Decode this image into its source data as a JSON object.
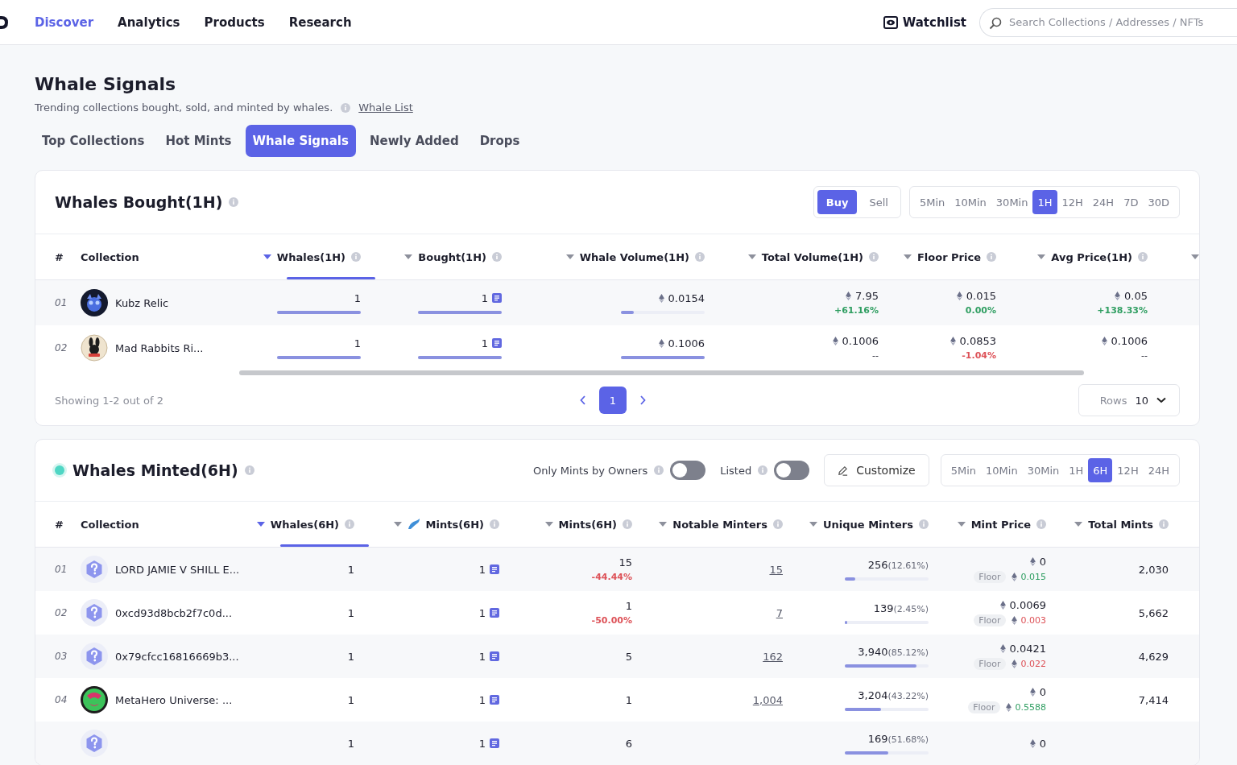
{
  "nav": {
    "items": [
      {
        "label": "Discover",
        "selected": true
      },
      {
        "label": "Analytics",
        "selected": false
      },
      {
        "label": "Products",
        "selected": false
      },
      {
        "label": "Research",
        "selected": false
      }
    ],
    "watchlist": "Watchlist",
    "search_placeholder": "Search Collections / Addresses / NFTs"
  },
  "page": {
    "title": "Whale Signals",
    "subtitle": "Trending collections bought, sold, and minted by whales.",
    "link": "Whale List"
  },
  "tabs": [
    {
      "label": "Top Collections",
      "selected": false
    },
    {
      "label": "Hot Mints",
      "selected": false
    },
    {
      "label": "Whale Signals",
      "selected": true
    },
    {
      "label": "Newly Added",
      "selected": false
    },
    {
      "label": "Drops",
      "selected": false
    }
  ],
  "bought": {
    "title": "Whales Bought(1H)",
    "modes": [
      {
        "label": "Buy",
        "selected": true
      },
      {
        "label": "Sell",
        "selected": false
      }
    ],
    "ranges": [
      {
        "label": "5Min",
        "selected": false
      },
      {
        "label": "10Min",
        "selected": false
      },
      {
        "label": "30Min",
        "selected": false
      },
      {
        "label": "1H",
        "selected": true
      },
      {
        "label": "12H",
        "selected": false
      },
      {
        "label": "24H",
        "selected": false
      },
      {
        "label": "7D",
        "selected": false
      },
      {
        "label": "30D",
        "selected": false
      }
    ],
    "columns": [
      {
        "label": "#",
        "kind": "index"
      },
      {
        "label": "Collection",
        "kind": "name"
      },
      {
        "label": "Whales(1H)",
        "kind": "sort",
        "selected": true
      },
      {
        "label": "Bought(1H)",
        "kind": "sort",
        "selected": false
      },
      {
        "label": "Whale Volume(1H)",
        "kind": "sort",
        "selected": false
      },
      {
        "label": "Total Volume(1H)",
        "kind": "sort",
        "selected": false
      },
      {
        "label": "Floor Price",
        "kind": "sort",
        "selected": false
      },
      {
        "label": "Avg Price(1H)",
        "kind": "sort",
        "selected": false
      }
    ],
    "rows": [
      {
        "index": "01",
        "name": "Kubz Relic",
        "avatar": {
          "kind": "kubz"
        },
        "whales": {
          "value": "1",
          "level": 1
        },
        "bought": {
          "value": "1",
          "level": 1
        },
        "volume": {
          "value": "0.0154",
          "level": 0.15
        },
        "total": {
          "value": "7.95",
          "change": {
            "text": "+61.16%",
            "kind": "up"
          }
        },
        "floor": {
          "value": "0.015",
          "change": {
            "text": "0.00%",
            "kind": "up"
          }
        },
        "avg": {
          "value": "0.05",
          "change": {
            "text": "+138.33%",
            "kind": "up"
          }
        }
      },
      {
        "index": "02",
        "name": "Mad Rabbits Ri...",
        "avatar": {
          "kind": "rabbit"
        },
        "whales": {
          "value": "1",
          "level": 1
        },
        "bought": {
          "value": "1",
          "level": 1
        },
        "volume": {
          "value": "0.1006",
          "level": 1
        },
        "total": {
          "value": "0.1006",
          "change": {
            "text": "--",
            "kind": "flat"
          }
        },
        "floor": {
          "value": "0.0853",
          "change": {
            "text": "-1.04%",
            "kind": "down"
          }
        },
        "avg": {
          "value": "0.1006",
          "change": {
            "text": "--",
            "kind": "flat"
          }
        }
      }
    ],
    "showing": "Showing 1-2 out of 2",
    "pages": [
      {
        "label": "1",
        "selected": true
      }
    ],
    "rows_label": "Rows",
    "rows_value": "10"
  },
  "minted": {
    "title": "Whales Minted(6H)",
    "filters": [
      {
        "label": "Only Mints by Owners",
        "on": false
      },
      {
        "label": "Listed",
        "on": false
      }
    ],
    "customize": "Customize",
    "ranges": [
      {
        "label": "5Min",
        "selected": false
      },
      {
        "label": "10Min",
        "selected": false
      },
      {
        "label": "30Min",
        "selected": false
      },
      {
        "label": "1H",
        "selected": false
      },
      {
        "label": "6H",
        "selected": true
      },
      {
        "label": "12H",
        "selected": false
      },
      {
        "label": "24H",
        "selected": false
      }
    ],
    "columns": [
      {
        "label": "#",
        "kind": "index"
      },
      {
        "label": "Collection",
        "kind": "name"
      },
      {
        "label": "Whales(6H)",
        "kind": "sort",
        "selected": true
      },
      {
        "label": "Mints(6H)",
        "kind": "whale_sort",
        "selected": false
      },
      {
        "label": "Mints(6H)",
        "kind": "sort",
        "selected": false
      },
      {
        "label": "Notable Minters",
        "kind": "sort",
        "selected": false
      },
      {
        "label": "Unique Minters",
        "kind": "sort",
        "selected": false
      },
      {
        "label": "Mint Price",
        "kind": "sort",
        "selected": false
      },
      {
        "label": "Total Mints",
        "kind": "sort",
        "selected": false
      }
    ],
    "rows": [
      {
        "index": "01",
        "name": "LORD JAMIE V SHILL E...",
        "avatar": {
          "kind": "unknown"
        },
        "whales": "1",
        "mints": "1",
        "mints6h": {
          "value": "15",
          "change": {
            "text": "-44.44%",
            "kind": "down"
          }
        },
        "notable": "15",
        "unique": {
          "value": "256",
          "share": "(12.61%)",
          "level": 0.1261
        },
        "price": {
          "value": "0",
          "floor_label": "Floor",
          "floor": {
            "text": "0.015",
            "kind": "up"
          }
        },
        "total": "2,030"
      },
      {
        "index": "02",
        "name": "0xcd93d8bcb2f7c0d...",
        "avatar": {
          "kind": "unknown"
        },
        "whales": "1",
        "mints": "1",
        "mints6h": {
          "value": "1",
          "change": {
            "text": "-50.00%",
            "kind": "down"
          }
        },
        "notable": "7",
        "unique": {
          "value": "139",
          "share": "(2.45%)",
          "level": 0.0245
        },
        "price": {
          "value": "0.0069",
          "floor_label": "Floor",
          "floor": {
            "text": "0.003",
            "kind": "down"
          }
        },
        "total": "5,662"
      },
      {
        "index": "03",
        "name": "0x79cfcc16816669b3...",
        "avatar": {
          "kind": "unknown"
        },
        "whales": "1",
        "mints": "1",
        "mints6h": {
          "value": "5"
        },
        "notable": "162",
        "unique": {
          "value": "3,940",
          "share": "(85.12%)",
          "level": 0.8512
        },
        "price": {
          "value": "0.0421",
          "floor_label": "Floor",
          "floor": {
            "text": "0.022",
            "kind": "down"
          }
        },
        "total": "4,629"
      },
      {
        "index": "04",
        "name": "MetaHero Universe: ...",
        "avatar": {
          "kind": "hero"
        },
        "whales": "1",
        "mints": "1",
        "mints6h": {
          "value": "1"
        },
        "notable": "1,004",
        "unique": {
          "value": "3,204",
          "share": "(43.22%)",
          "level": 0.4322
        },
        "price": {
          "value": "0",
          "floor_label": "Floor",
          "floor": {
            "text": "0.5588",
            "kind": "up"
          }
        },
        "total": "7,414"
      },
      {
        "avatar": {
          "kind": "unknown"
        },
        "whales": "1",
        "mints": "1",
        "mints6h": {
          "value": "6"
        },
        "unique": {
          "value": "169",
          "share": "(51.68%)",
          "level": 0.5168
        },
        "price": {
          "value": "0"
        }
      }
    ]
  }
}
